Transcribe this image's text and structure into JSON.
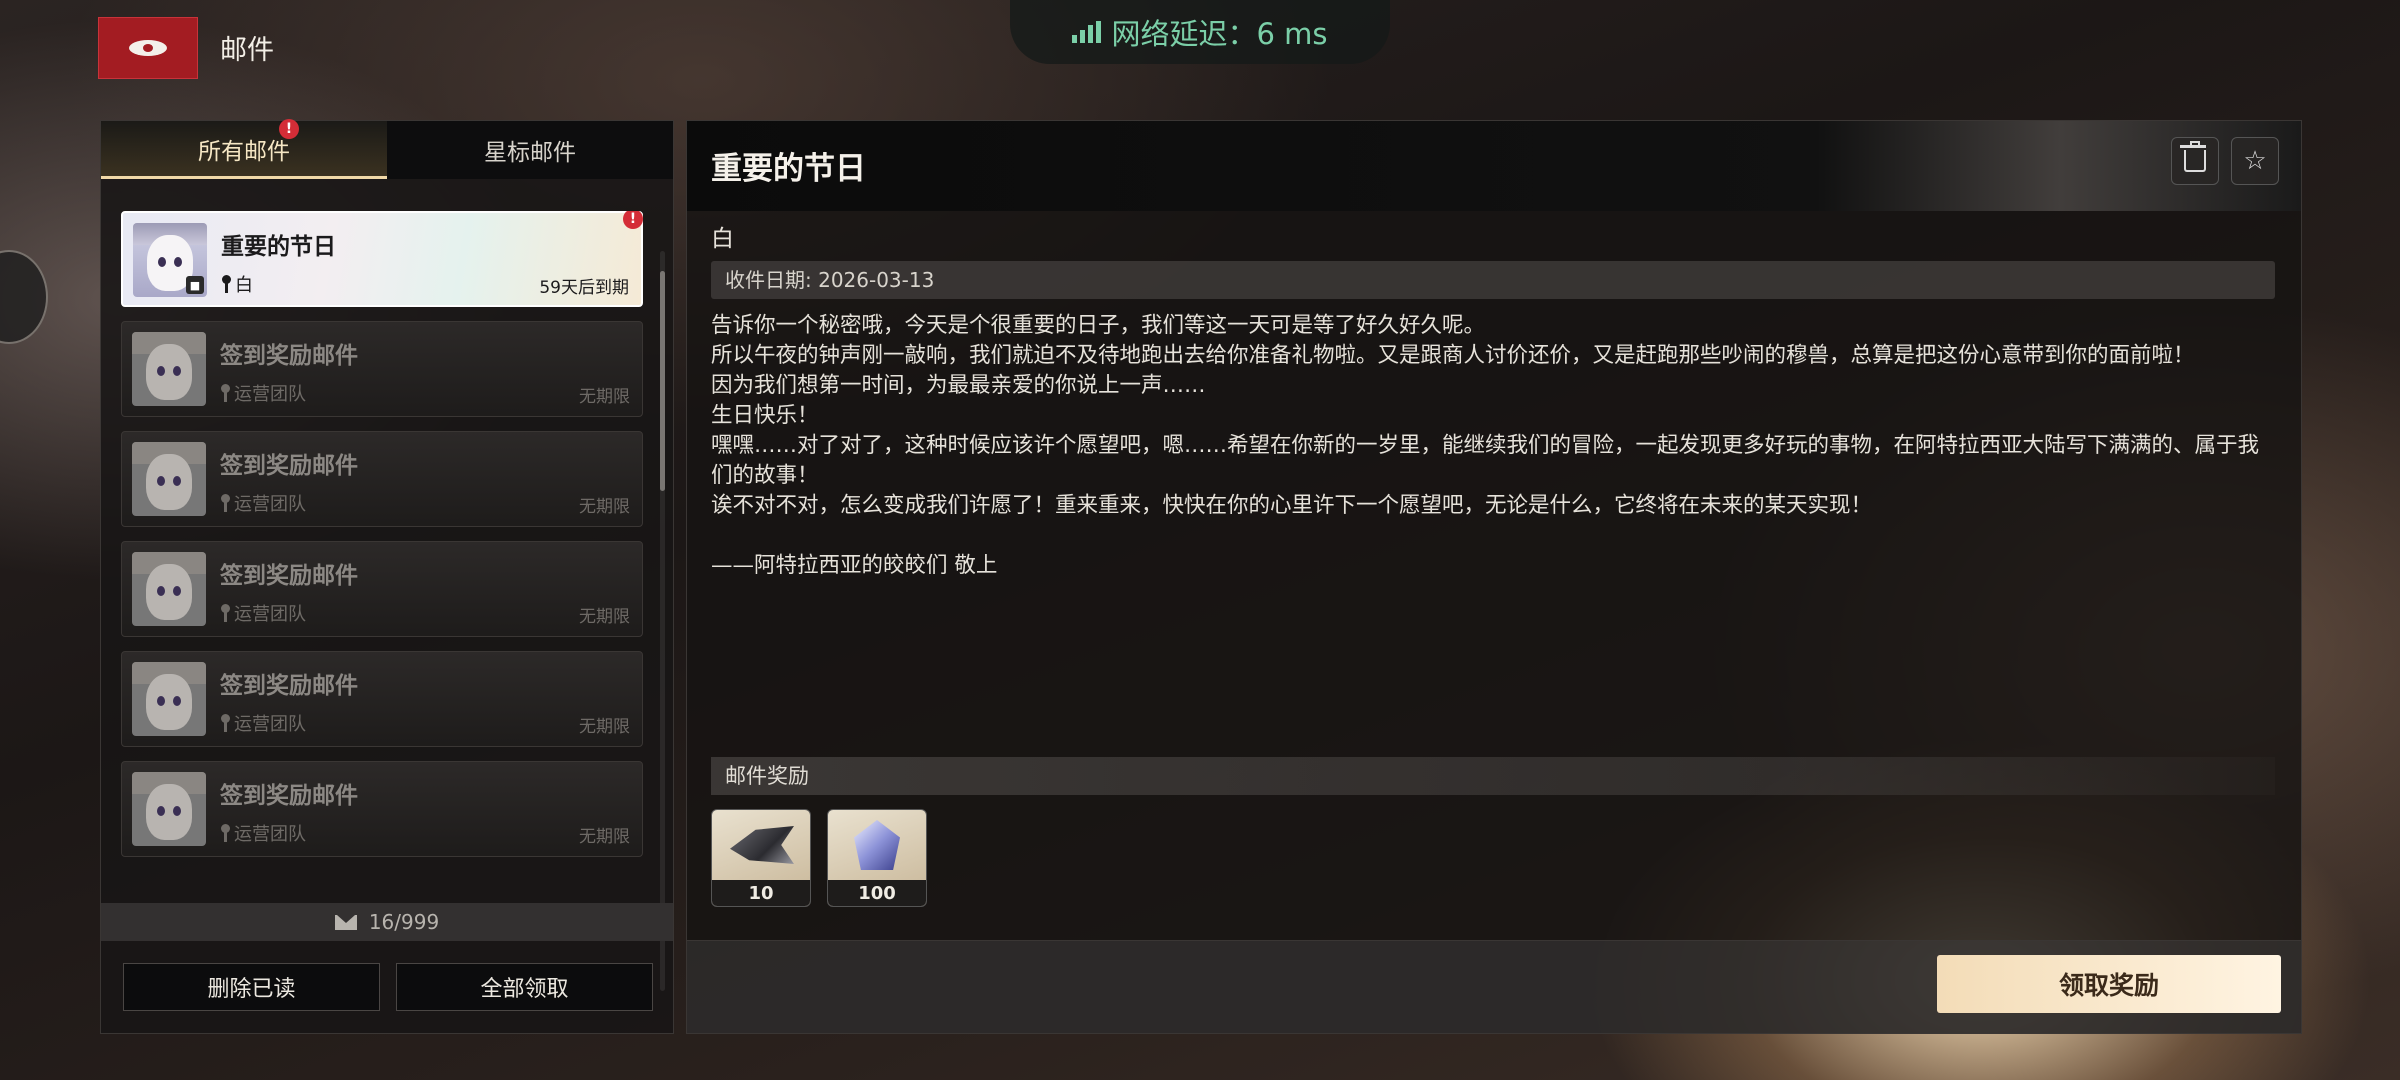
{
  "header": {
    "title": "邮件",
    "latency_label": "网络延迟：6 ms",
    "latency_color": "#7bcfa8"
  },
  "tabs": [
    {
      "label": "所有邮件",
      "active": true,
      "badge": "!"
    },
    {
      "label": "星标邮件",
      "active": false
    }
  ],
  "mail_list": [
    {
      "title": "重要的节日",
      "sender": "白",
      "expiry": "59天后到期",
      "selected": true,
      "badge": "!"
    },
    {
      "title": "签到奖励邮件",
      "sender": "运营团队",
      "expiry": "无期限"
    },
    {
      "title": "签到奖励邮件",
      "sender": "运营团队",
      "expiry": "无期限"
    },
    {
      "title": "签到奖励邮件",
      "sender": "运营团队",
      "expiry": "无期限"
    },
    {
      "title": "签到奖励邮件",
      "sender": "运营团队",
      "expiry": "无期限"
    },
    {
      "title": "签到奖励邮件",
      "sender": "运营团队",
      "expiry": "无期限"
    }
  ],
  "mail_count": "16/999",
  "left_buttons": {
    "delete_read": "删除已读",
    "claim_all": "全部领取"
  },
  "detail": {
    "title": "重要的节日",
    "sender": "白",
    "received_date": "收件日期: 2026-03-13",
    "body": [
      "告诉你一个秘密哦，今天是个很重要的日子，我们等这一天可是等了好久好久呢。",
      "所以午夜的钟声刚一敲响，我们就迫不及待地跑出去给你准备礼物啦。又是跟商人讨价还价，又是赶跑那些吵闹的穆兽，总算是把这份心意带到你的面前啦！",
      "因为我们想第一时间，为最最亲爱的你说上一声……",
      "生日快乐！",
      "嘿嘿……对了对了，这种时候应该许个愿望吧，嗯……希望在你新的一岁里，能继续我们的冒险，一起发现更多好玩的事物，在阿特拉西亚大陆写下满满的、属于我们的故事！",
      "诶不对不对，怎么变成我们许愿了！重来重来，快快在你的心里许下一个愿望吧，无论是什么，它终将在未来的某天实现！",
      "",
      "——阿特拉西亚的皎皎们 敬上"
    ],
    "rewards_label": "邮件奖励",
    "rewards": [
      {
        "qty": "10",
        "icon": "feather-material-icon"
      },
      {
        "qty": "100",
        "icon": "crystal-gem-icon"
      }
    ],
    "claim_label": "领取奖励"
  },
  "colors": {
    "accent_red": "#a31c22",
    "badge_red": "#d42d37",
    "claim_button": "#f3dcb7"
  }
}
